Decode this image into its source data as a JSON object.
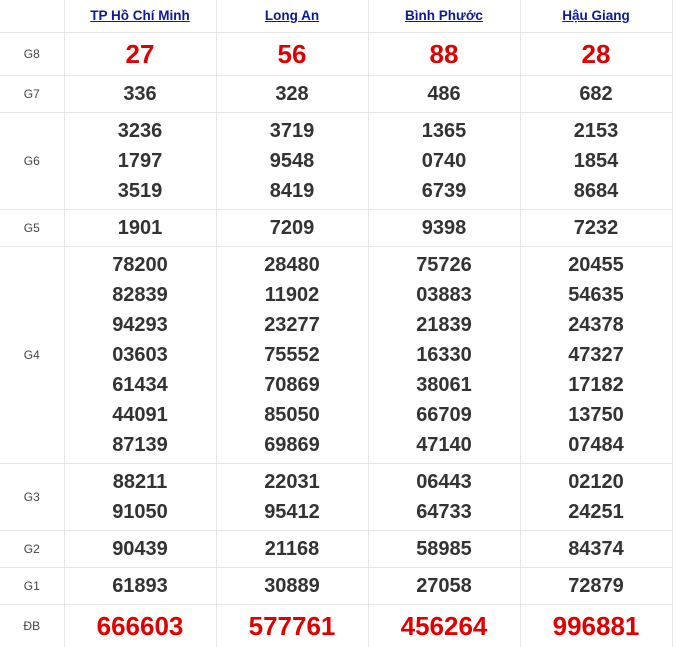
{
  "provinces": [
    "TP Hồ Chí Minh",
    "Long An",
    "Bình Phước",
    "Hậu Giang"
  ],
  "prizes": [
    {
      "label": "G8",
      "values": [
        [
          "27"
        ],
        [
          "56"
        ],
        [
          "88"
        ],
        [
          "28"
        ]
      ]
    },
    {
      "label": "G7",
      "values": [
        [
          "336"
        ],
        [
          "328"
        ],
        [
          "486"
        ],
        [
          "682"
        ]
      ]
    },
    {
      "label": "G6",
      "values": [
        [
          "3236",
          "1797",
          "3519"
        ],
        [
          "3719",
          "9548",
          "8419"
        ],
        [
          "1365",
          "0740",
          "6739"
        ],
        [
          "2153",
          "1854",
          "8684"
        ]
      ]
    },
    {
      "label": "G5",
      "values": [
        [
          "1901"
        ],
        [
          "7209"
        ],
        [
          "9398"
        ],
        [
          "7232"
        ]
      ]
    },
    {
      "label": "G4",
      "values": [
        [
          "78200",
          "82839",
          "94293",
          "03603",
          "61434",
          "44091",
          "87139"
        ],
        [
          "28480",
          "11902",
          "23277",
          "75552",
          "70869",
          "85050",
          "69869"
        ],
        [
          "75726",
          "03883",
          "21839",
          "16330",
          "38061",
          "66709",
          "47140"
        ],
        [
          "20455",
          "54635",
          "24378",
          "47327",
          "17182",
          "13750",
          "07484"
        ]
      ]
    },
    {
      "label": "G3",
      "values": [
        [
          "88211",
          "91050"
        ],
        [
          "22031",
          "95412"
        ],
        [
          "06443",
          "64733"
        ],
        [
          "02120",
          "24251"
        ]
      ]
    },
    {
      "label": "G2",
      "values": [
        [
          "90439"
        ],
        [
          "21168"
        ],
        [
          "58985"
        ],
        [
          "84374"
        ]
      ]
    },
    {
      "label": "G1",
      "values": [
        [
          "61893"
        ],
        [
          "30889"
        ],
        [
          "27058"
        ],
        [
          "72879"
        ]
      ]
    },
    {
      "label": "ĐB",
      "values": [
        [
          "666603"
        ],
        [
          "577761"
        ],
        [
          "456264"
        ],
        [
          "996881"
        ]
      ]
    }
  ],
  "colors": {
    "header_link": "#0b1a9a",
    "highlight": "#e00000",
    "number": "#333333",
    "border": "#e6e6e6"
  }
}
